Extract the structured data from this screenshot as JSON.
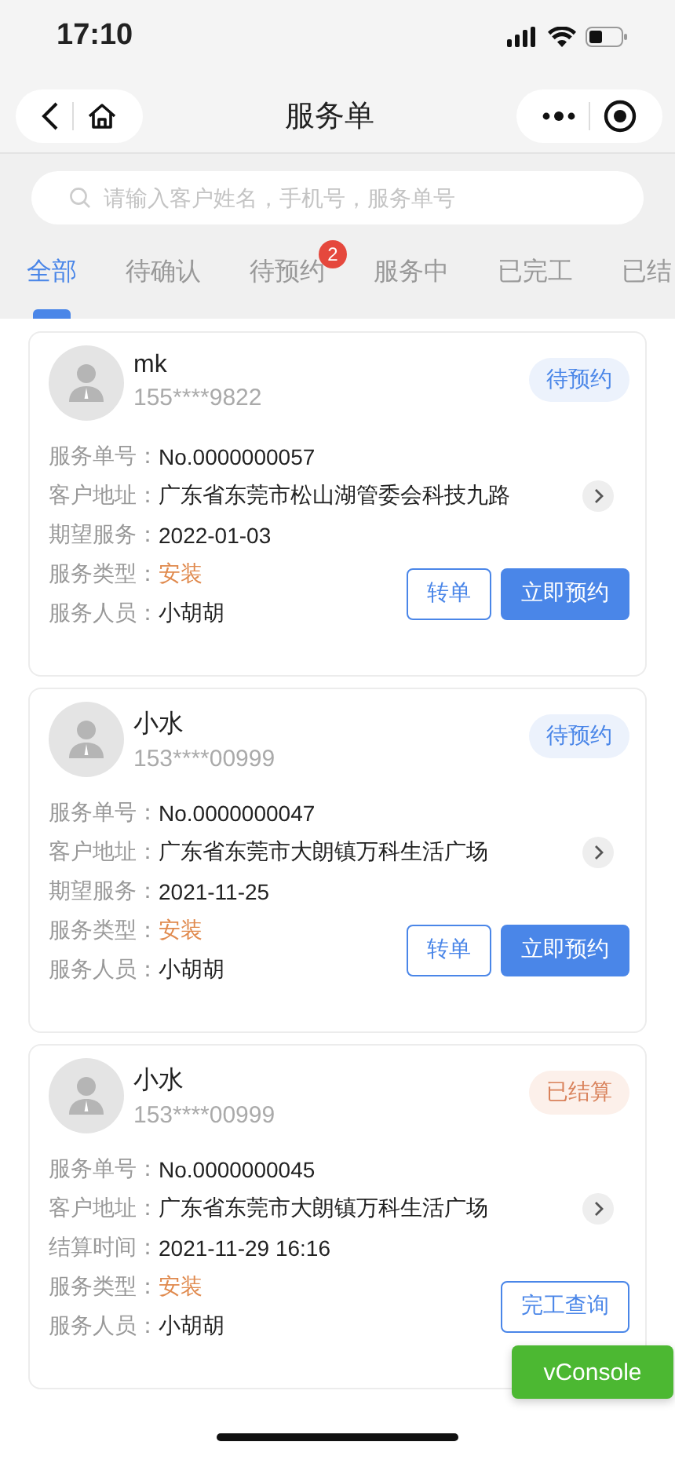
{
  "status_bar": {
    "time": "17:10"
  },
  "nav": {
    "title": "服务单"
  },
  "search": {
    "placeholder": "请输入客户姓名，手机号，服务单号"
  },
  "tabs": [
    {
      "label": "全部",
      "selected": true
    },
    {
      "label": "待确认",
      "selected": false
    },
    {
      "label": "待预约",
      "selected": false,
      "badge": "2"
    },
    {
      "label": "服务中",
      "selected": false
    },
    {
      "label": "已完工",
      "selected": false
    },
    {
      "label": "已结",
      "selected": false
    }
  ],
  "orders": [
    {
      "name": "mk",
      "phone": "155****9822",
      "status": {
        "label": "待预约",
        "kind": "pending"
      },
      "fields": [
        {
          "label": "服务单号：",
          "value": "No.0000000057",
          "kind": "text"
        },
        {
          "label": "客户地址：",
          "value": "广东省东莞市松山湖管委会科技九路",
          "kind": "link"
        },
        {
          "label": "期望服务：",
          "value": "2022-01-03",
          "kind": "text"
        },
        {
          "label": "服务类型：",
          "value": "安装",
          "kind": "accent"
        },
        {
          "label": "服务人员：",
          "value": "小胡胡",
          "kind": "text"
        }
      ],
      "buttons": [
        {
          "label": "转单",
          "kind": "outline"
        },
        {
          "label": "立即预约",
          "kind": "primary"
        }
      ]
    },
    {
      "name": "小水",
      "phone": "153****00999",
      "status": {
        "label": "待预约",
        "kind": "pending"
      },
      "fields": [
        {
          "label": "服务单号：",
          "value": "No.0000000047",
          "kind": "text"
        },
        {
          "label": "客户地址：",
          "value": "广东省东莞市大朗镇万科生活广场",
          "kind": "link"
        },
        {
          "label": "期望服务：",
          "value": "2021-11-25",
          "kind": "text"
        },
        {
          "label": "服务类型：",
          "value": "安装",
          "kind": "accent"
        },
        {
          "label": "服务人员：",
          "value": "小胡胡",
          "kind": "text"
        }
      ],
      "buttons": [
        {
          "label": "转单",
          "kind": "outline"
        },
        {
          "label": "立即预约",
          "kind": "primary"
        }
      ]
    },
    {
      "name": "小水",
      "phone": "153****00999",
      "status": {
        "label": "已结算",
        "kind": "settled"
      },
      "fields": [
        {
          "label": "服务单号：",
          "value": "No.0000000045",
          "kind": "text"
        },
        {
          "label": "客户地址：",
          "value": "广东省东莞市大朗镇万科生活广场",
          "kind": "link"
        },
        {
          "label": "结算时间：",
          "value": "2021-11-29 16:16",
          "kind": "text"
        },
        {
          "label": "服务类型：",
          "value": "安装",
          "kind": "accent"
        },
        {
          "label": "服务人员：",
          "value": "小胡胡",
          "kind": "text"
        }
      ],
      "buttons": [
        {
          "label": "完工查询",
          "kind": "outline"
        }
      ]
    }
  ],
  "floating_button": {
    "label": "vConsole"
  }
}
